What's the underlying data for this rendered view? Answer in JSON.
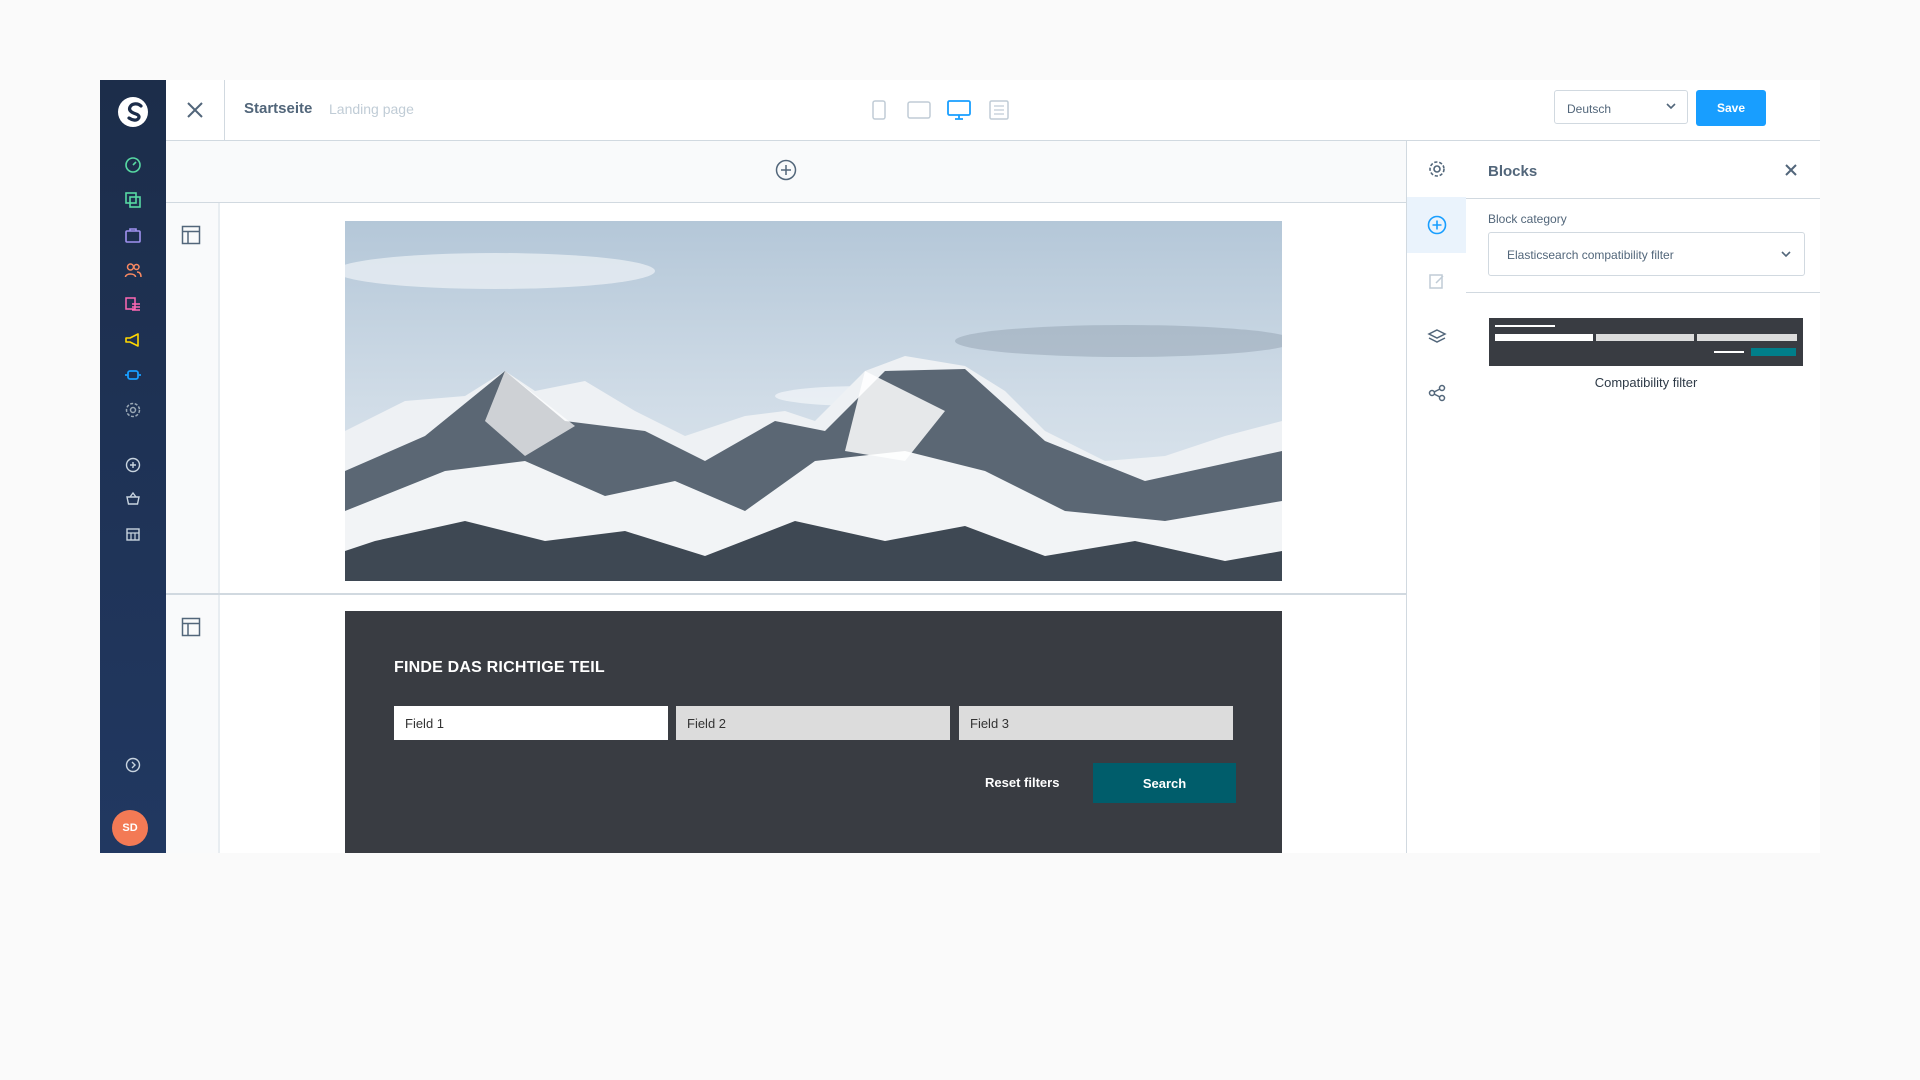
{
  "topbar": {
    "page_title": "Startseite",
    "page_type": "Landing page",
    "language": "Deutsch",
    "save_label": "Save"
  },
  "user": {
    "initials": "SD"
  },
  "filter_block": {
    "title": "FINDE DAS RICHTIGE TEIL",
    "fields": [
      "Field 1",
      "Field 2",
      "Field 3"
    ],
    "reset_label": "Reset filters",
    "search_label": "Search"
  },
  "panel": {
    "title": "Blocks",
    "category_label": "Block category",
    "category_value": "Elasticsearch compatibility filter",
    "block_label": "Compatibility filter"
  },
  "nav": {
    "icons": [
      "dashboard-icon",
      "catalogue-icon",
      "orders-icon",
      "customers-icon",
      "content-icon",
      "marketing-icon",
      "extensions-icon",
      "settings-icon",
      "add-icon",
      "shop-basket-icon",
      "storefront-icon",
      "collapse-icon"
    ],
    "colors": {
      "dashboard": "#57d9a3",
      "catalogue": "#57d9a3",
      "orders": "#a092f0",
      "customers": "#f88962",
      "content": "#ff68b4",
      "marketing": "#ffd700",
      "extensions": "#189eff",
      "settings": "#9aa8b5"
    }
  },
  "accent_color": "#189eff"
}
